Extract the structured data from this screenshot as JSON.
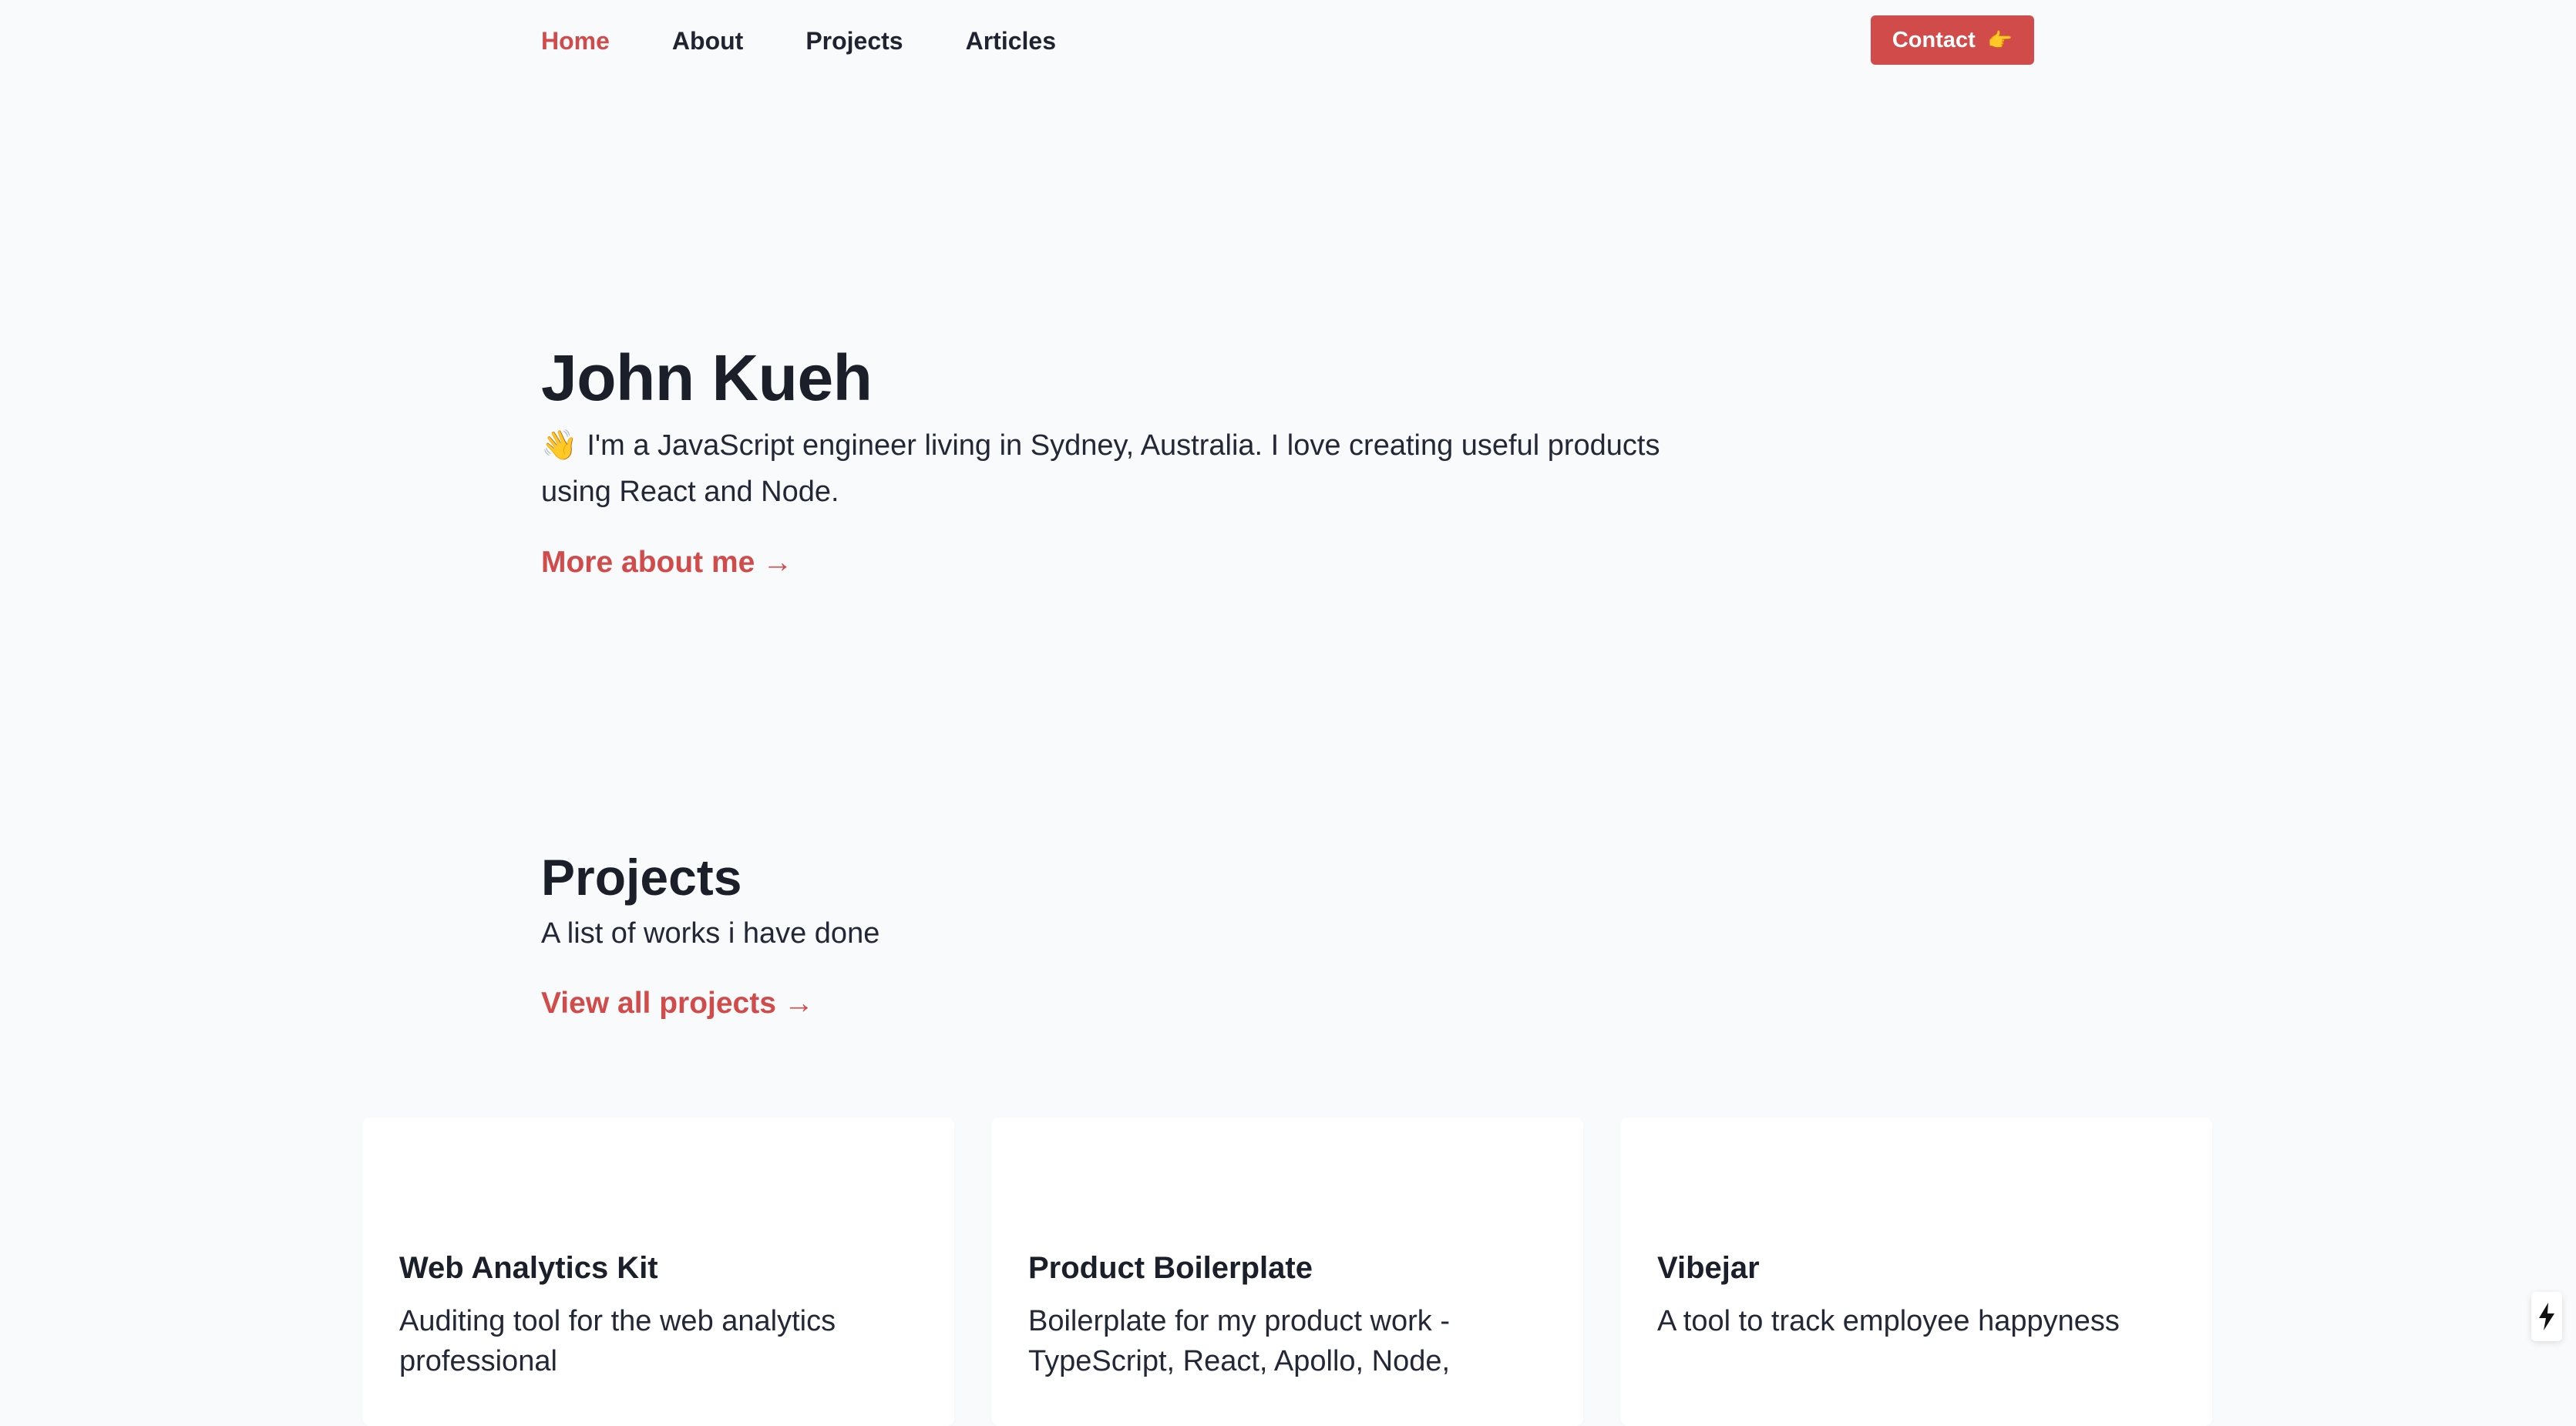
{
  "nav": {
    "links": [
      {
        "label": "Home",
        "active": true
      },
      {
        "label": "About",
        "active": false
      },
      {
        "label": "Projects",
        "active": false
      },
      {
        "label": "Articles",
        "active": false
      }
    ],
    "contact_label": "Contact",
    "contact_emoji": "👉",
    "accent_color": "#d14b4b"
  },
  "hero": {
    "name": "John Kueh",
    "wave": "👋",
    "intro": "I'm a JavaScript engineer living in Sydney, Australia. I love creating useful products using React and Node.",
    "more_link": "More about me",
    "arrow": "→"
  },
  "projects": {
    "title": "Projects",
    "subtitle": "A list of works i have done",
    "view_all": "View all projects",
    "arrow": "→",
    "cards": [
      {
        "title": "Web Analytics Kit",
        "description": "Auditing tool for the web analytics professional"
      },
      {
        "title": "Product Boilerplate",
        "description": "Boilerplate for my product work - TypeScript, React, Apollo, Node,"
      },
      {
        "title": "Vibejar",
        "description": "A tool to track employee happyness"
      }
    ]
  },
  "dev_indicator": {
    "icon": "lightning-bolt-icon"
  }
}
